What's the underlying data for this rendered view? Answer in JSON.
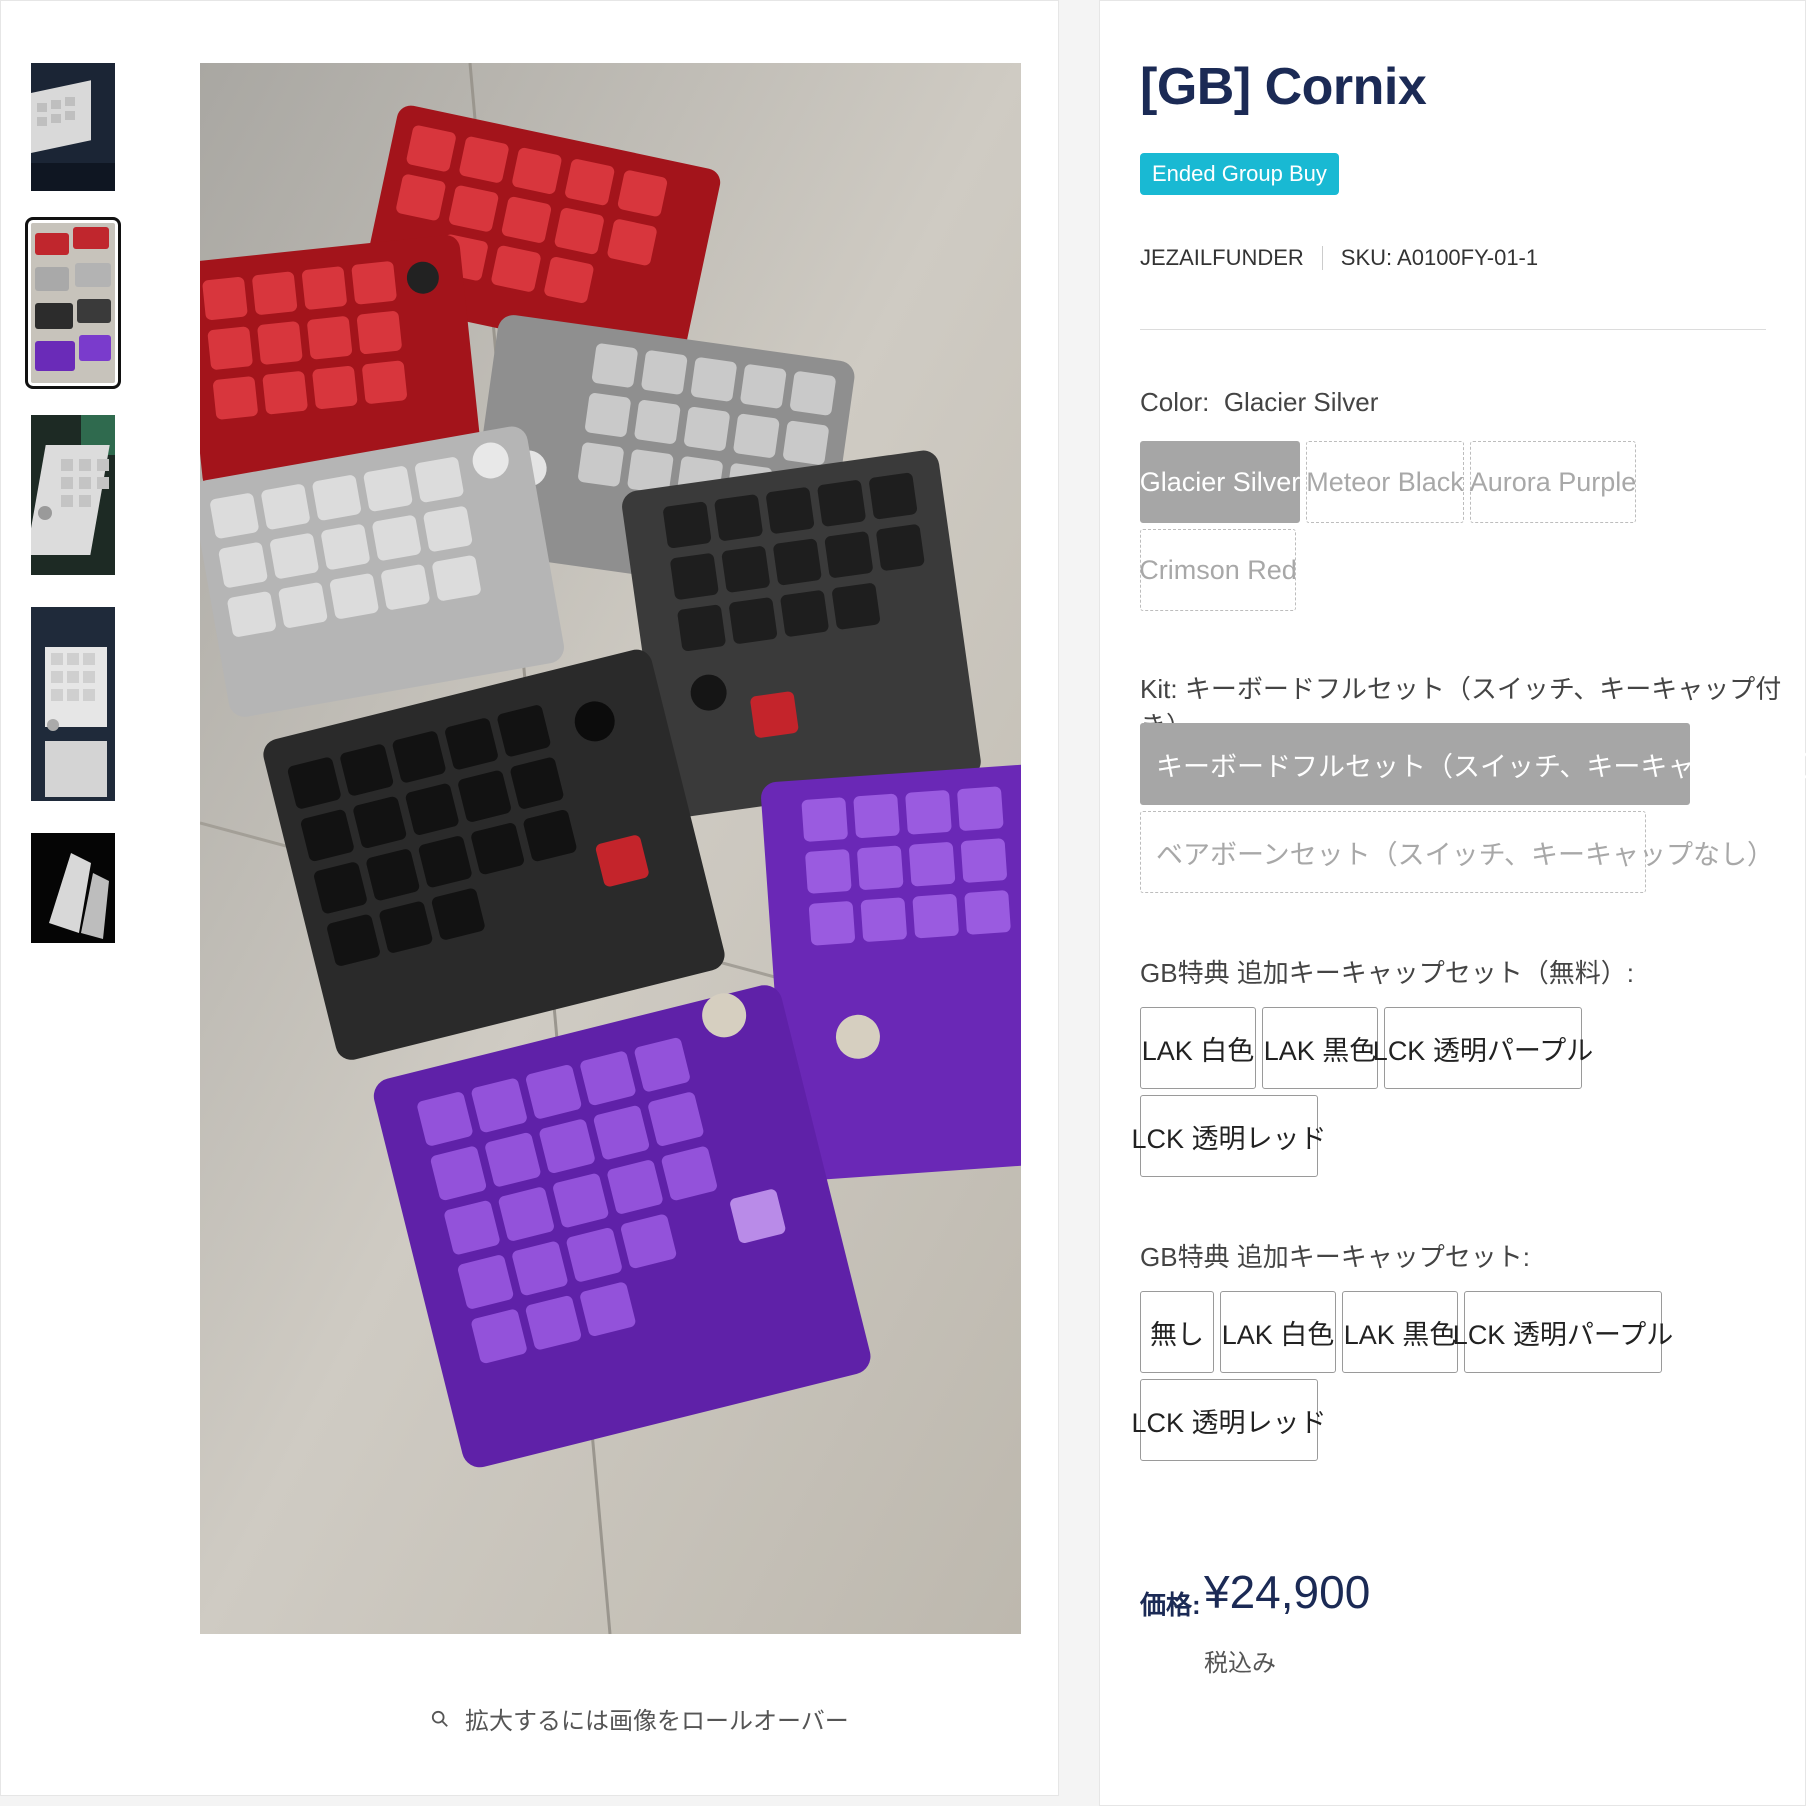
{
  "product": {
    "title": "[GB] Cornix",
    "badge": "Ended Group Buy",
    "vendor": "JEZAILFUNDER",
    "sku": "SKU: A0100FY-01-1"
  },
  "gallery": {
    "thumbnails": [
      "thumbnail-1",
      "thumbnail-2",
      "thumbnail-3",
      "thumbnail-4",
      "thumbnail-5"
    ],
    "selected_index": 1,
    "zoom_hint": "拡大するには画像をロールオーバー",
    "zoom_icon": "search-icon"
  },
  "options": {
    "color": {
      "label": "Color:",
      "selected": "Glacier Silver",
      "values": [
        "Glacier Silver",
        "Meteor Black",
        "Aurora Purple",
        "Crimson Red"
      ]
    },
    "kit": {
      "label": "Kit:",
      "selected": "キーボードフルセット（スイッチ、キーキャップ付き）",
      "values": [
        "キーボードフルセット（スイッチ、キーキャップ付き）",
        "ベアボーンセット（スイッチ、キーキャップなし）"
      ]
    },
    "bonus_free": {
      "label": "GB特典 追加キーキャップセット（無料）:",
      "values": [
        "LAK 白色",
        "LAK 黒色",
        "LCK 透明パープル",
        "LCK 透明レッド"
      ]
    },
    "bonus_extra": {
      "label": "GB特典 追加キーキャップセット:",
      "values": [
        "無し",
        "LAK 白色",
        "LAK 黒色",
        "LCK 透明パープル",
        "LCK 透明レッド"
      ]
    }
  },
  "price": {
    "label": "価格:",
    "value": "¥24,900",
    "tax_note": "税込み"
  },
  "colors": {
    "title": "#1b2a55",
    "badge": "#19b9d3",
    "selected_option": "#a6a6a6"
  }
}
